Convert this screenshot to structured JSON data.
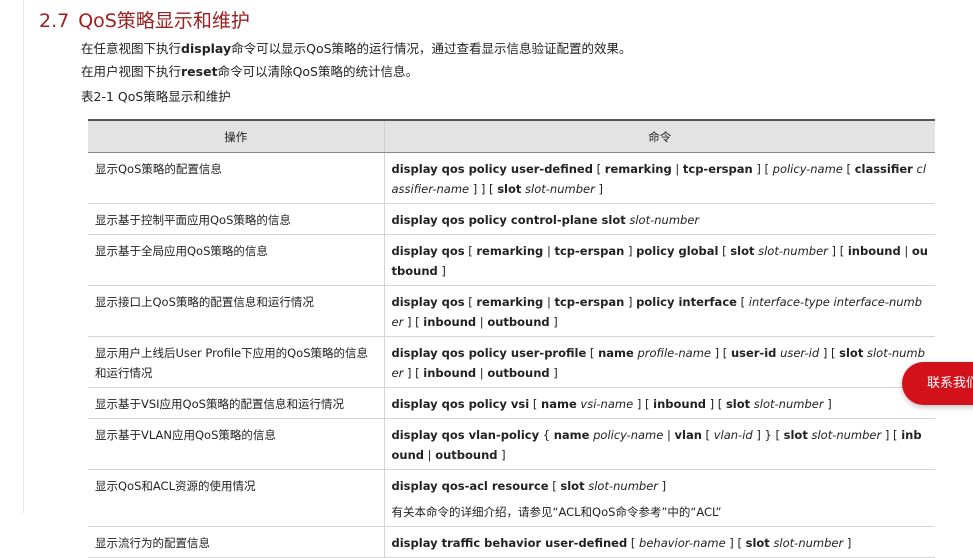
{
  "section": {
    "number": "2.7",
    "title": "QoS策略显示和维护"
  },
  "paragraphs": [
    {
      "prefix": "在任意视图下执行",
      "keyword": "display",
      "suffix": "命令可以显示QoS策略的运行情况，通过查看显示信息验证配置的效果。"
    },
    {
      "prefix": "在用户视图下执行",
      "keyword": "reset",
      "suffix": "命令可以清除QoS策略的统计信息。"
    }
  ],
  "table_caption": "表2-1 QoS策略显示和维护",
  "table": {
    "headers": [
      "操作",
      "命令"
    ],
    "rows": [
      {
        "operation": "显示QoS策略的配置信息",
        "command": [
          [
            "k",
            "display qos policy user-defined"
          ],
          [
            "s",
            " [ "
          ],
          [
            "k",
            "remarking"
          ],
          [
            "s",
            " | "
          ],
          [
            "k",
            "tcp-erspan"
          ],
          [
            "s",
            " ] [ "
          ],
          [
            "a",
            "policy-name"
          ],
          [
            "s",
            " [ "
          ],
          [
            "k",
            "classifier"
          ],
          [
            "s",
            " "
          ],
          [
            "a",
            "classifier-name"
          ],
          [
            "s",
            " ] ] [ "
          ],
          [
            "k",
            "slot"
          ],
          [
            "s",
            " "
          ],
          [
            "a",
            "slot-number"
          ],
          [
            "s",
            " ]"
          ]
        ]
      },
      {
        "operation": "显示基于控制平面应用QoS策略的信息",
        "command": [
          [
            "k",
            "display qos policy control-plane slot"
          ],
          [
            "s",
            " "
          ],
          [
            "a",
            "slot-number"
          ]
        ]
      },
      {
        "operation": "显示基于全局应用QoS策略的信息",
        "command": [
          [
            "k",
            "display qos"
          ],
          [
            "s",
            " [ "
          ],
          [
            "k",
            "remarking"
          ],
          [
            "s",
            " | "
          ],
          [
            "k",
            "tcp-erspan"
          ],
          [
            "s",
            " ] "
          ],
          [
            "k",
            "policy global"
          ],
          [
            "s",
            " [ "
          ],
          [
            "k",
            "slot"
          ],
          [
            "s",
            " "
          ],
          [
            "a",
            "slot-number"
          ],
          [
            "s",
            " ] [ "
          ],
          [
            "k",
            "inbound"
          ],
          [
            "s",
            " | "
          ],
          [
            "k",
            "outbound"
          ],
          [
            "s",
            " ]"
          ]
        ]
      },
      {
        "operation": "显示接口上QoS策略的配置信息和运行情况",
        "command": [
          [
            "k",
            "display qos"
          ],
          [
            "s",
            " [ "
          ],
          [
            "k",
            "remarking"
          ],
          [
            "s",
            " | "
          ],
          [
            "k",
            "tcp-erspan"
          ],
          [
            "s",
            " ] "
          ],
          [
            "k",
            "policy interface"
          ],
          [
            "s",
            " [ "
          ],
          [
            "a",
            "interface-type interface-number"
          ],
          [
            "s",
            " ] [ "
          ],
          [
            "k",
            "inbound"
          ],
          [
            "s",
            " | "
          ],
          [
            "k",
            "outbound"
          ],
          [
            "s",
            " ]"
          ]
        ]
      },
      {
        "operation": "显示用户上线后User Profile下应用的QoS策略的信息和运行情况",
        "command": [
          [
            "k",
            "display qos policy user-profile"
          ],
          [
            "s",
            " [ "
          ],
          [
            "k",
            "name"
          ],
          [
            "s",
            " "
          ],
          [
            "a",
            "profile-name"
          ],
          [
            "s",
            " ] [ "
          ],
          [
            "k",
            "user-id"
          ],
          [
            "s",
            " "
          ],
          [
            "a",
            "user-id"
          ],
          [
            "s",
            " ] [ "
          ],
          [
            "k",
            "slot"
          ],
          [
            "s",
            " "
          ],
          [
            "a",
            "slot-number"
          ],
          [
            "s",
            " ] [ "
          ],
          [
            "k",
            "inbound"
          ],
          [
            "s",
            " | "
          ],
          [
            "k",
            "outbound"
          ],
          [
            "s",
            " ]"
          ]
        ]
      },
      {
        "operation": "显示基于VSI应用QoS策略的配置信息和运行情况",
        "command": [
          [
            "k",
            "display qos policy vsi"
          ],
          [
            "s",
            " [ "
          ],
          [
            "k",
            "name"
          ],
          [
            "s",
            " "
          ],
          [
            "a",
            "vsi-name"
          ],
          [
            "s",
            " ] [ "
          ],
          [
            "k",
            "inbound"
          ],
          [
            "s",
            " ] [ "
          ],
          [
            "k",
            "slot"
          ],
          [
            "s",
            " "
          ],
          [
            "a",
            "slot-number"
          ],
          [
            "s",
            " ]"
          ]
        ]
      },
      {
        "operation": "显示基于VLAN应用QoS策略的信息",
        "command": [
          [
            "k",
            "display qos vlan-policy"
          ],
          [
            "s",
            " { "
          ],
          [
            "k",
            "name"
          ],
          [
            "s",
            " "
          ],
          [
            "a",
            "policy-name"
          ],
          [
            "s",
            " | "
          ],
          [
            "k",
            "vlan"
          ],
          [
            "s",
            " [ "
          ],
          [
            "a",
            "vlan-id"
          ],
          [
            "s",
            " ] } [ "
          ],
          [
            "k",
            "slot"
          ],
          [
            "s",
            " "
          ],
          [
            "a",
            "slot-number"
          ],
          [
            "s",
            " ] [ "
          ],
          [
            "k",
            "inbound"
          ],
          [
            "s",
            " | "
          ],
          [
            "k",
            "outbound"
          ],
          [
            "s",
            " ]"
          ]
        ]
      },
      {
        "operation": "显示QoS和ACL资源的使用情况",
        "command": [
          [
            "k",
            "display qos-acl resource"
          ],
          [
            "s",
            " [ "
          ],
          [
            "k",
            "slot"
          ],
          [
            "s",
            " "
          ],
          [
            "a",
            "slot-number"
          ],
          [
            "s",
            " ]"
          ]
        ],
        "note": "有关本命令的详细介绍，请参见“ACL和QoS命令参考”中的“ACL”"
      },
      {
        "operation": "显示流行为的配置信息",
        "command": [
          [
            "k",
            "display traffic behavior user-defined"
          ],
          [
            "s",
            " [ "
          ],
          [
            "a",
            "behavior-name"
          ],
          [
            "s",
            " ] [ "
          ],
          [
            "k",
            "slot"
          ],
          [
            "s",
            " "
          ],
          [
            "a",
            "slot-number"
          ],
          [
            "s",
            " ]"
          ]
        ]
      }
    ]
  },
  "contact_button": {
    "label": "联系我们"
  },
  "colors": {
    "section_title": "#a01e1e",
    "header_bg": "#e3e3e3",
    "contact_bg": "#d3111b"
  }
}
